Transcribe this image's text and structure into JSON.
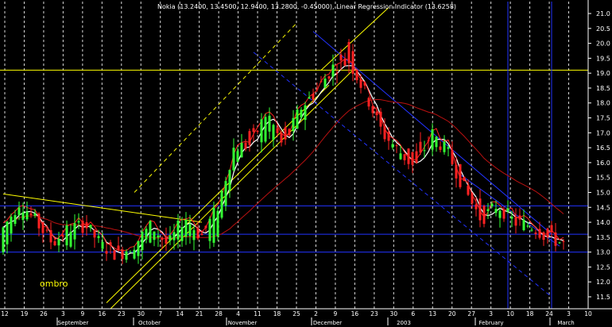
{
  "chart_data": {
    "type": "candlestick",
    "title": "Nokia (13.2400, 13.4500, 12.9400, 13.2800, -0.45000), Linear Regression Indicator (13.6258)",
    "watermark": "ombro",
    "ylim": [
      11.1,
      21.4
    ],
    "yticks": [
      "11.5",
      "12.0",
      "12.5",
      "13.0",
      "13.5",
      "14.0",
      "14.5",
      "15.0",
      "15.5",
      "16.0",
      "16.5",
      "17.0",
      "17.5",
      "18.0",
      "18.5",
      "19.0",
      "19.5",
      "20.0",
      "20.5",
      "21.0"
    ],
    "xticks": [
      "12",
      "19",
      "26",
      "3",
      "9",
      "16",
      "23",
      "30",
      "7",
      "14",
      "21",
      "28",
      "4",
      "11",
      "18",
      "25",
      "2",
      "9",
      "16",
      "23",
      "30",
      "6",
      "13",
      "20",
      "27",
      "3",
      "10",
      "18",
      "24",
      "3",
      "10"
    ],
    "month_labels": [
      "September",
      "October",
      "November",
      "December",
      "2003",
      "February",
      "March"
    ],
    "ohlc_control_points": [
      [
        13.0,
        13.8
      ],
      [
        14.2,
        14.7
      ],
      [
        14.4,
        14.0
      ],
      [
        13.6,
        13.3
      ],
      [
        13.2,
        13.8
      ],
      [
        14.2,
        13.9
      ],
      [
        13.3,
        13.2
      ],
      [
        13.2,
        12.9
      ],
      [
        12.7,
        13.3
      ],
      [
        13.6,
        13.9
      ],
      [
        13.4,
        13.2
      ],
      [
        13.4,
        14.2
      ],
      [
        13.8,
        13.5
      ],
      [
        13.3,
        14.5
      ],
      [
        15.8,
        16.5
      ],
      [
        17.0,
        16.6
      ],
      [
        16.8,
        17.7
      ],
      [
        17.0,
        16.5
      ],
      [
        17.2,
        17.8
      ],
      [
        18.6,
        18.4
      ],
      [
        18.9,
        19.2
      ],
      [
        20.0,
        19.4
      ],
      [
        18.6,
        18.3
      ],
      [
        17.4,
        17.0
      ],
      [
        16.3,
        16.4
      ],
      [
        16.4,
        15.8
      ],
      [
        16.6,
        17.0
      ],
      [
        16.6,
        16.3
      ],
      [
        15.6,
        15.1
      ],
      [
        14.5,
        14.1
      ],
      [
        14.2,
        14.6
      ],
      [
        14.2,
        14.0
      ],
      [
        13.8,
        13.9
      ],
      [
        13.9,
        13.5
      ],
      [
        13.3,
        13.28
      ]
    ],
    "overlays": [
      {
        "name": "Linear Regression Indicator",
        "value": 13.6258,
        "color": "#ffffff"
      },
      {
        "name": "",
        "color": "#ff2222"
      },
      {
        "name": "",
        "color": "#bb1111"
      }
    ],
    "horizontal_lines": [
      {
        "value": 19.1,
        "color": "#ffff00"
      },
      {
        "value": 14.55,
        "color": "#2233ff"
      },
      {
        "value": 13.6,
        "color": "#2233ff"
      },
      {
        "value": 13.0,
        "color": "#2233ff"
      }
    ],
    "trend_lines": [
      {
        "from": [
          0,
          14.95
        ],
        "to": [
          50,
          14.0
        ],
        "color": "#ffff00",
        "dash": false
      },
      {
        "from": [
          26,
          11.3
        ],
        "to": [
          82,
          18.6
        ],
        "color": "#ffff00",
        "dash": false
      },
      {
        "from": [
          27,
          11.1
        ],
        "to": [
          88,
          19.1
        ],
        "color": "#ffff00",
        "dash": false
      },
      {
        "from": [
          33,
          15.0
        ],
        "to": [
          74,
          20.7
        ],
        "color": "#ffff00",
        "dash": true
      },
      {
        "from": [
          80,
          19.1
        ],
        "to": [
          97,
          21.2
        ],
        "color": "#ffff00",
        "dash": false
      },
      {
        "from": [
          78,
          20.4
        ],
        "to": [
          138,
          13.6
        ],
        "color": "#2233ff",
        "dash": false
      },
      {
        "from": [
          63,
          19.7
        ],
        "to": [
          138,
          11.5
        ],
        "color": "#2233ff",
        "dash": true
      },
      {
        "from": [
          115,
          15.6
        ],
        "to": [
          140,
          13.2
        ],
        "color": "#2233ff",
        "dash": false
      }
    ],
    "vertical_lines": [
      {
        "bar": 127,
        "color": "#2233ff"
      },
      {
        "bar": 138,
        "color": "#2233ff"
      }
    ],
    "grid": true,
    "legend": "none"
  }
}
